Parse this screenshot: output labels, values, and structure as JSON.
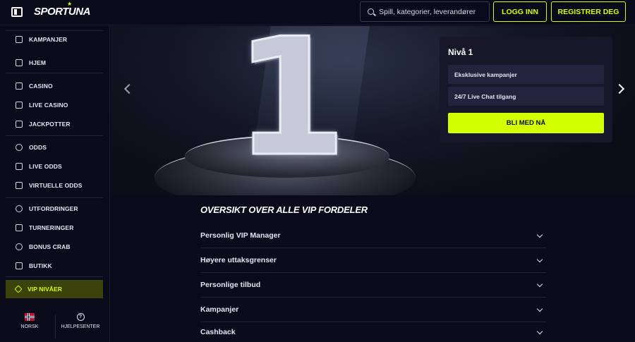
{
  "header": {
    "logo": "SPORTUNA",
    "search_placeholder": "Spill, kategorier, leverandører",
    "login_label": "LOGG INN",
    "register_label": "REGISTRER DEG"
  },
  "sidebar": {
    "items": [
      {
        "label": "KAMPANJER",
        "icon": "gift-icon"
      },
      {
        "label": "HJEM",
        "icon": "home-icon"
      },
      {
        "label": "CASINO",
        "icon": "casino-icon"
      },
      {
        "label": "LIVE CASINO",
        "icon": "card-icon"
      },
      {
        "label": "JACKPOTTER",
        "icon": "seven-icon"
      },
      {
        "label": "ODDS",
        "icon": "football-icon"
      },
      {
        "label": "LIVE ODDS",
        "icon": "live-tv-icon"
      },
      {
        "label": "VIRTUELLE ODDS",
        "icon": "gamepad-icon"
      },
      {
        "label": "UTFORDRINGER",
        "icon": "target-icon"
      },
      {
        "label": "TURNERINGER",
        "icon": "trophy-icon"
      },
      {
        "label": "BONUS CRAB",
        "icon": "crab-icon"
      },
      {
        "label": "BUTIKK",
        "icon": "shop-icon"
      },
      {
        "label": "VIP NIVÅER",
        "icon": "diamond-icon"
      }
    ],
    "language_label": "NORSK",
    "help_label": "HJELPESENTER"
  },
  "hero": {
    "level_title": "Nivå 1",
    "features": [
      "Eksklusive kampanjer",
      "24/7 Live Chat tilgang"
    ],
    "join_label": "BLI MED NÅ",
    "badge_number": "1"
  },
  "benefits": {
    "title": "OVERSIKT OVER ALLE VIP FORDELER",
    "items": [
      "Personlig VIP Manager",
      "Høyere uttaksgrenser",
      "Personlige tilbud",
      "Kampanjer",
      "Cashback"
    ]
  },
  "colors": {
    "accent": "#d4ff00",
    "background": "#0b0a1a",
    "card": "#181729"
  }
}
